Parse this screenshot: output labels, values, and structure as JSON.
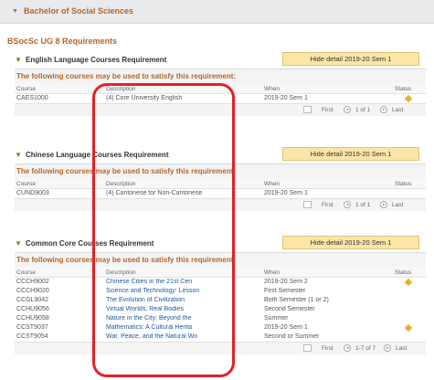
{
  "program": {
    "title": "Bachelor of Social Sciences"
  },
  "requirements_title": "BSocSc UG 8 Requirements",
  "common": {
    "hide_label": "Hide detail 2019-20 Sem 1",
    "bar_text": "The following courses may be used to satisfy this requirement:",
    "columns": {
      "course": "Course",
      "description": "Description",
      "when": "When",
      "status": "Status"
    },
    "pager": {
      "first": "First",
      "last": "Last"
    }
  },
  "sections": [
    {
      "title": "English Language Courses Requirement",
      "rows": [
        {
          "course": "CAES1000",
          "description": "(4) Core University English",
          "when": "2019-20 Sem 1",
          "status": "in-progress"
        }
      ],
      "pager_range": "1 of 1"
    },
    {
      "title": "Chinese Language Courses Requirement",
      "rows": [
        {
          "course": "CUND9003",
          "description": "(4) Cantonese for Non-Cantonese",
          "when": "2019-20 Sem 1",
          "status": ""
        }
      ],
      "pager_range": "1 of 1"
    },
    {
      "title": "Common Core Courses Requirement",
      "rows": [
        {
          "course": "CCCH9002",
          "description": "Chinese Cities in the 21st Cen",
          "when": "2019-20 Sem 2",
          "status": "in-progress"
        },
        {
          "course": "CCCH9020",
          "description": "Science and Technology: Lesson",
          "when": "First Semester",
          "status": ""
        },
        {
          "course": "CCGL9042",
          "description": "The Evolution of Civilization",
          "when": "Both Semester (1 or 2)",
          "status": ""
        },
        {
          "course": "CCHU9056",
          "description": "Virtual Worlds, Real Bodies",
          "when": "Second Semester",
          "status": ""
        },
        {
          "course": "CCHU9058",
          "description": "Nature in the City: Beyond the",
          "when": "Summer",
          "status": ""
        },
        {
          "course": "CCST9037",
          "description": "Mathematics: A Cultural Herita",
          "when": "2019-20 Sem 1",
          "status": "in-progress"
        },
        {
          "course": "CCST9054",
          "description": "War, Peace, and the Natural Wo",
          "when": "Second or Summer",
          "status": ""
        }
      ],
      "pager_range": "1-7 of 7"
    }
  ],
  "colors": {
    "accent": "#b5652b",
    "button_bg": "#fbe6a7",
    "link": "#1f5aa0",
    "status": "#e7b32b",
    "highlight": "#e3202a"
  },
  "icons": {
    "collapse": "triangle-down-icon",
    "status": "diamond-icon",
    "nav": "circle-arrow-icon",
    "grid": "grid-view-icon"
  }
}
